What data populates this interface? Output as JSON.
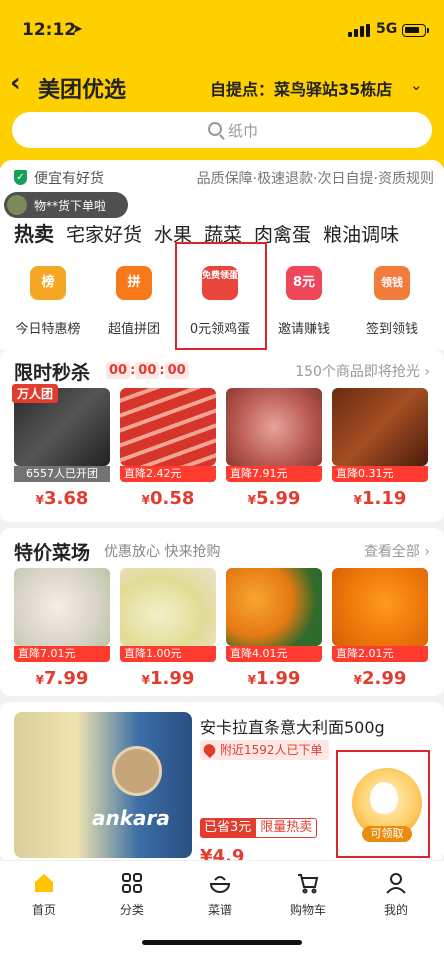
{
  "status_bar": {
    "time": "12:12",
    "network": "5G"
  },
  "header": {
    "back_icon": "chevron-left-icon",
    "title": "美团优选",
    "pickup_label": "自提点：",
    "pickup_point": "菜鸟驿站35栋店"
  },
  "search": {
    "placeholder": "纸巾"
  },
  "guarantee": {
    "tag": "便宜有好货",
    "items": "品质保障·极速退款·次日自提·资质规则"
  },
  "toast": {
    "text": "物**货下单啦"
  },
  "tabs": [
    {
      "label": "热卖",
      "active": true
    },
    {
      "label": "宅家好货",
      "active": false
    },
    {
      "label": "水果",
      "active": false
    },
    {
      "label": "蔬菜",
      "active": false
    },
    {
      "label": "肉禽蛋",
      "active": false
    },
    {
      "label": "粮油调味",
      "active": false
    }
  ],
  "categories": [
    {
      "label": "今日特惠榜",
      "icon_text": "榜",
      "color": "#f5a623"
    },
    {
      "label": "超值拼团",
      "icon_text": "拼",
      "color": "#f7791b"
    },
    {
      "label": "0元领鸡蛋",
      "icon_text": "免费领蛋",
      "color": "#e8453c"
    },
    {
      "label": "邀请赚钱",
      "icon_text": "8元",
      "color": "#f0465a"
    },
    {
      "label": "签到领钱",
      "icon_text": "领钱",
      "color": "#f27b3e"
    }
  ],
  "flash_sale": {
    "title": "限时秒杀",
    "timer": [
      "00",
      "00",
      "00"
    ],
    "right_text": "150个商品即将抢光",
    "group_badge": "万人团",
    "opened_text": "6557人已开团",
    "products": [
      {
        "drop": "",
        "price": "3.68"
      },
      {
        "drop": "直降2.42元",
        "price": "0.58"
      },
      {
        "drop": "直降7.91元",
        "price": "5.99"
      },
      {
        "drop": "直降0.31元",
        "price": "1.19"
      }
    ]
  },
  "veg_market": {
    "title": "特价菜场",
    "subtitle": "优惠放心 快来抢购",
    "right_text": "查看全部",
    "products": [
      {
        "drop": "直降7.01元",
        "price": "7.99"
      },
      {
        "drop": "直降1.00元",
        "price": "1.99"
      },
      {
        "drop": "直降4.01元",
        "price": "1.99"
      },
      {
        "drop": "直降2.01元",
        "price": "2.99"
      }
    ]
  },
  "feature_card": {
    "title": "安卡拉直条意大利面500g",
    "nearby": "附近1592人已下单",
    "saved": "已省3元",
    "tag": "限量热卖",
    "price": "¥4.9",
    "brand": "ankara",
    "egg_badge": "可领取"
  },
  "tabbar": [
    {
      "label": "首页",
      "icon": "home-icon"
    },
    {
      "label": "分类",
      "icon": "grid-icon"
    },
    {
      "label": "菜谱",
      "icon": "recipe-icon"
    },
    {
      "label": "购物车",
      "icon": "cart-icon"
    },
    {
      "label": "我的",
      "icon": "user-icon"
    }
  ]
}
